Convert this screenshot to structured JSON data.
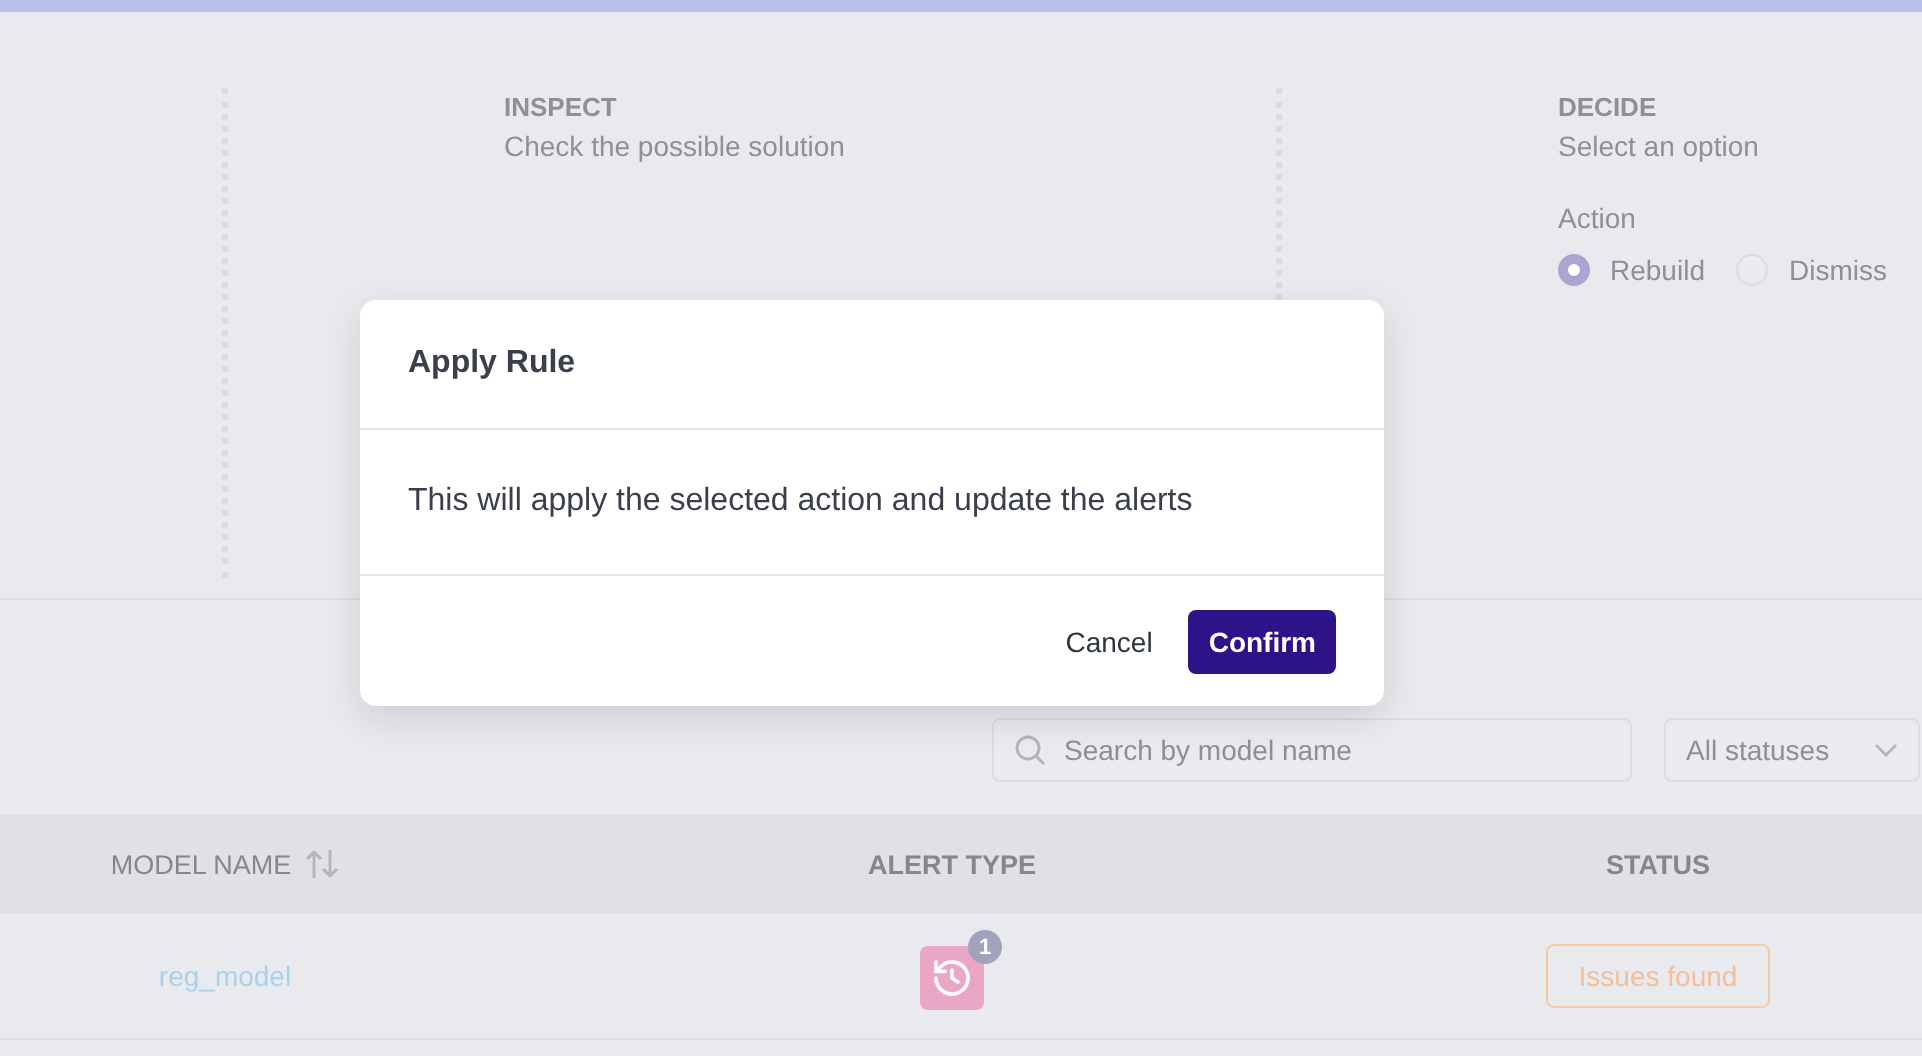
{
  "steps": [
    {
      "title": "INSPECT",
      "subtitle": "Check the possible solution"
    },
    {
      "title": "DECIDE",
      "subtitle": "Select an option",
      "field_label": "Action",
      "options": [
        {
          "label": "Rebuild",
          "selected": true
        },
        {
          "label": "Dismiss",
          "selected": false
        }
      ]
    }
  ],
  "filters": {
    "search": {
      "placeholder": "Search by model name"
    },
    "status": {
      "value": "All statuses"
    }
  },
  "table": {
    "columns": [
      {
        "label": "MODEL NAME",
        "sortable": true
      },
      {
        "label": "ALERT TYPE",
        "sortable": false
      },
      {
        "label": "STATUS",
        "sortable": false
      }
    ],
    "rows": [
      {
        "model_name": "reg_model",
        "alert_count": "1",
        "status": "Issues found"
      }
    ]
  },
  "dialog": {
    "title": "Apply Rule",
    "message": "This will apply the selected action and update the alerts",
    "buttons": [
      {
        "label": "Cancel",
        "kind": "secondary"
      },
      {
        "label": "Confirm",
        "kind": "primary"
      }
    ]
  }
}
